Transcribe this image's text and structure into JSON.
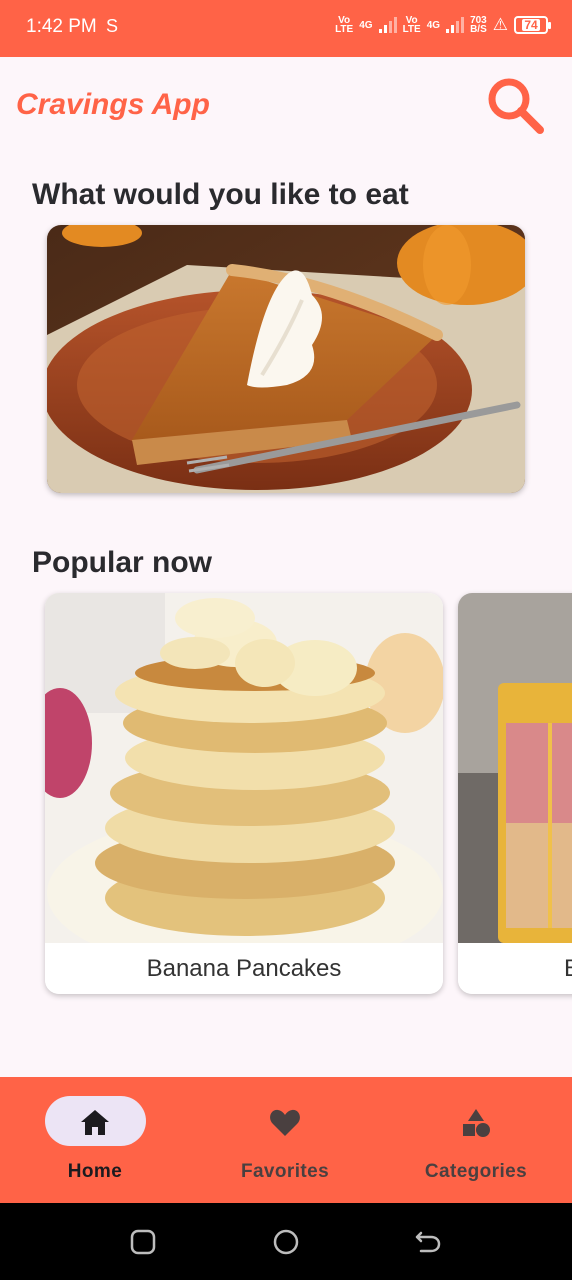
{
  "status_bar": {
    "time": "1:42 PM",
    "sync_glyph": "S",
    "sim1_top": "Vo",
    "sim1_bottom": "LTE",
    "net1": "4G",
    "sim2_top": "Vo",
    "sim2_bottom": "LTE",
    "net2": "4G",
    "speed_top": "703",
    "speed_bottom": "B/S",
    "alert_glyph": "⚠",
    "battery": "74"
  },
  "app_bar": {
    "title": "Cravings App",
    "search_icon": "search-icon"
  },
  "sections": {
    "featured_title": "What would you like to eat",
    "popular_title": "Popular now"
  },
  "featured": {
    "image": "pumpkin-pie-with-whipped-cream"
  },
  "popular": [
    {
      "name": "Banana Pancakes",
      "image": "banana-pancakes-stack"
    },
    {
      "name": "B",
      "image": "layered-cake"
    }
  ],
  "bottom_nav": {
    "items": [
      {
        "label": "Home",
        "icon": "home-icon",
        "selected": true
      },
      {
        "label": "Favorites",
        "icon": "heart-icon",
        "selected": false
      },
      {
        "label": "Categories",
        "icon": "shapes-icon",
        "selected": false
      }
    ]
  },
  "colors": {
    "primary": "#ff6347",
    "background": "#fdf6fa",
    "selected_pill": "#ece4f5",
    "title_text": "#2a2a2e"
  }
}
